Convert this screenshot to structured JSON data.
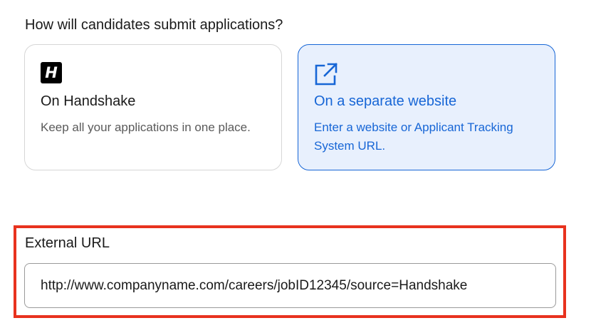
{
  "form": {
    "question": "How will candidates submit applications?",
    "options": [
      {
        "logo_text": "H",
        "icon": "handshake-logo-icon",
        "title": "On Handshake",
        "description": "Keep all your applications in one place.",
        "selected": false
      },
      {
        "icon": "external-link-icon",
        "title": "On a separate website",
        "description": "Enter a website or Applicant Tracking System URL.",
        "selected": true
      }
    ],
    "external_url": {
      "label": "External URL",
      "value": "http://www.companyname.com/careers/jobID12345/source=Handshake"
    }
  },
  "colors": {
    "accent": "#1766d6",
    "selected_bg": "#e8f0fd",
    "highlight": "#e8321e"
  }
}
